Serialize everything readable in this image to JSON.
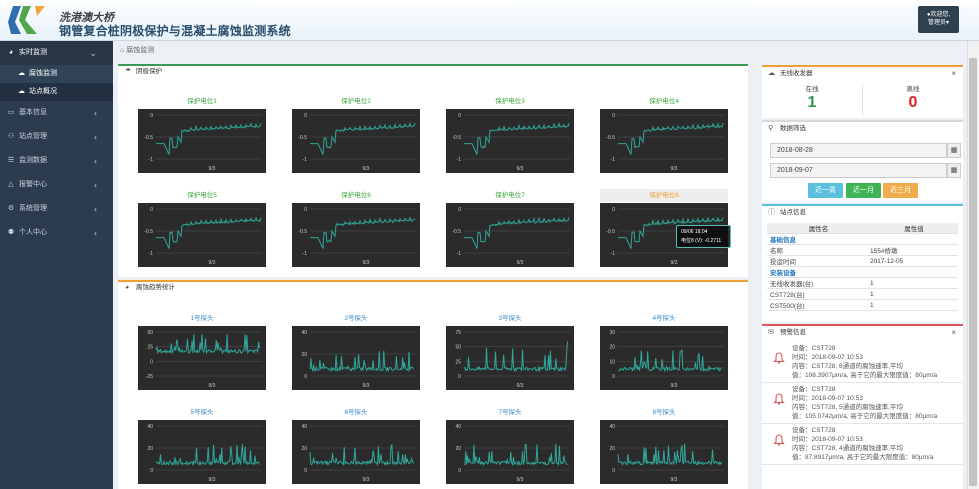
{
  "header": {
    "brand": "洗港澳大桥",
    "title": "钢管复合桩阴极保护与混凝土腐蚀监测系统",
    "user_greeting": "欢迎您,",
    "user_name": "管理员"
  },
  "sidebar": {
    "items": [
      {
        "label": "实时监测",
        "icon": "globe-icon",
        "open": true,
        "children": [
          {
            "label": "腐蚀监测",
            "icon": "cloud-icon",
            "active": true
          },
          {
            "label": "站点概况",
            "icon": "cloud-icon",
            "active": false
          }
        ]
      },
      {
        "label": "基本信息",
        "icon": "laptop-icon"
      },
      {
        "label": "站点管理",
        "icon": "users-icon"
      },
      {
        "label": "监测数据",
        "icon": "columns-icon"
      },
      {
        "label": "报警中心",
        "icon": "bell-icon"
      },
      {
        "label": "系统管理",
        "icon": "gear-icon"
      },
      {
        "label": "个人中心",
        "icon": "user-icon"
      }
    ]
  },
  "breadcrumb": "腐蚀监测",
  "cathodic": {
    "title": "阴极保护",
    "charts": [
      {
        "title": "保护电位1"
      },
      {
        "title": "保护电位2"
      },
      {
        "title": "保护电位3"
      },
      {
        "title": "保护电位4"
      },
      {
        "title": "保护电位5"
      },
      {
        "title": "保护电位6"
      },
      {
        "title": "保护电位7"
      },
      {
        "title": "保护电位8",
        "highlighted": true
      }
    ],
    "yticks": [
      "0",
      "-0.5",
      "-1"
    ],
    "xtick": "9/3",
    "tooltip": {
      "time": "09/06 18:04",
      "label": "电位8 (V)",
      "value": "-0.2711"
    }
  },
  "corrosion": {
    "title": "腐蚀趋势统计",
    "charts": [
      {
        "title": "1号探头",
        "yticks": [
          "50",
          "25",
          "0",
          "-25"
        ]
      },
      {
        "title": "2号探头",
        "yticks": [
          "40",
          "20",
          "0"
        ]
      },
      {
        "title": "3号探头",
        "yticks": [
          "75",
          "50",
          "25",
          "0"
        ]
      },
      {
        "title": "4号探头",
        "yticks": [
          "30",
          "20",
          "10",
          "0"
        ]
      },
      {
        "title": "5号探头",
        "yticks": [
          "40",
          "20",
          "0"
        ]
      },
      {
        "title": "6号探头",
        "yticks": [
          "40",
          "20",
          "0"
        ]
      },
      {
        "title": "7号探头",
        "yticks": [
          "40",
          "20",
          "0"
        ]
      },
      {
        "title": "8号探头",
        "yticks": [
          "40",
          "20",
          "0"
        ]
      }
    ],
    "xtick": "9/3"
  },
  "receiver": {
    "title": "无线收发器",
    "online_label": "在线",
    "online_value": "1",
    "offline_label": "离线",
    "offline_value": "0"
  },
  "filter": {
    "title": "数据筛选",
    "date_from": "2018-08-28",
    "date_to": "2018-09-07",
    "btn_week": "近一周",
    "btn_month": "近一月",
    "btn_quarter": "近三月"
  },
  "station": {
    "title": "站点信息",
    "col_name": "属性名",
    "col_value": "属性值",
    "rows": [
      {
        "type": "section",
        "name": "基础信息"
      },
      {
        "name": "名称",
        "value": "155#桥墩"
      },
      {
        "name": "投运时间",
        "value": "2017-12-05"
      },
      {
        "type": "section",
        "name": "安装设备"
      },
      {
        "name": "无线收发器(台)",
        "value": "1"
      },
      {
        "name": "CST728(台)",
        "value": "1"
      },
      {
        "name": "CST500(台)",
        "value": "1"
      }
    ]
  },
  "alarms": {
    "title": "预警信息",
    "items": [
      {
        "device": "设备：CST728",
        "time": "时间：2018-09-07 10:53",
        "content1": "内容：CST728, 6通道的腐蚀速率,平均",
        "content2": "值：108.3907μm/a, 高于它的最大限度值：80μm/a"
      },
      {
        "device": "设备：CST728",
        "time": "时间：2018-09-07 10:53",
        "content1": "内容：CST728, 5通道的腐蚀速率,平均",
        "content2": "值：105.0742μm/a, 高于它的最大限度值：80μm/a"
      },
      {
        "device": "设备：CST728",
        "time": "时间：2018-09-07 10:53",
        "content1": "内容：CST728, 4通道的腐蚀速率,平均",
        "content2": "值：87.8917μm/a, 高于它的最大限度值：80μm/a"
      }
    ]
  },
  "colors": {
    "accent": "#3a9a53",
    "teal": "#2fa79a",
    "sidebar": "#2c3b4e",
    "alarm": "#e05555",
    "warn": "#f0a030"
  }
}
